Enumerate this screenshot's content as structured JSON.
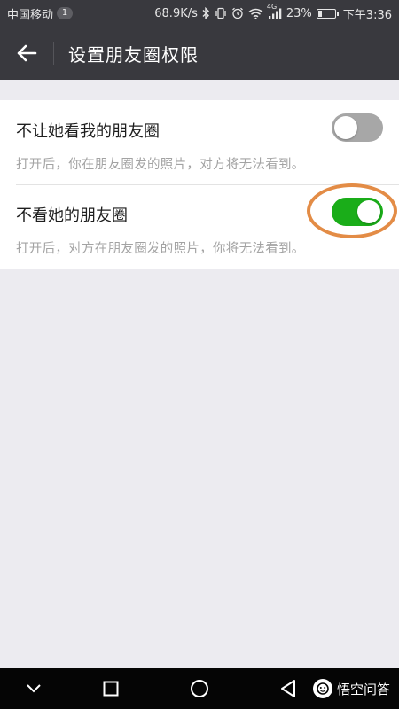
{
  "status_bar": {
    "carrier": "中国移动",
    "notification_count": "1",
    "network_speed": "68.9K/s",
    "network_type": "4G",
    "battery_percent": "23%",
    "battery_level": 0.23,
    "time": "下午3:36"
  },
  "title_bar": {
    "back_icon": "arrow-left-icon",
    "title": "设置朋友圈权限"
  },
  "settings": [
    {
      "label": "不让她看我的朋友圈",
      "description": "打开后，你在朋友圈发的照片，对方将无法看到。",
      "enabled": false
    },
    {
      "label": "不看她的朋友圈",
      "description": "打开后，对方在朋友圈发的照片，你将无法看到。",
      "enabled": true
    }
  ],
  "colors": {
    "header_bg": "#39393E",
    "page_bg": "#ECEBF0",
    "toggle_on": "#1AAD19",
    "toggle_off": "#A7A7A7",
    "highlight": "#E38C46"
  },
  "watermark": {
    "text": "悟空问答"
  },
  "nav_bar": {
    "icons": [
      "chevron-down-icon",
      "square-icon",
      "circle-icon",
      "triangle-back-icon"
    ]
  }
}
